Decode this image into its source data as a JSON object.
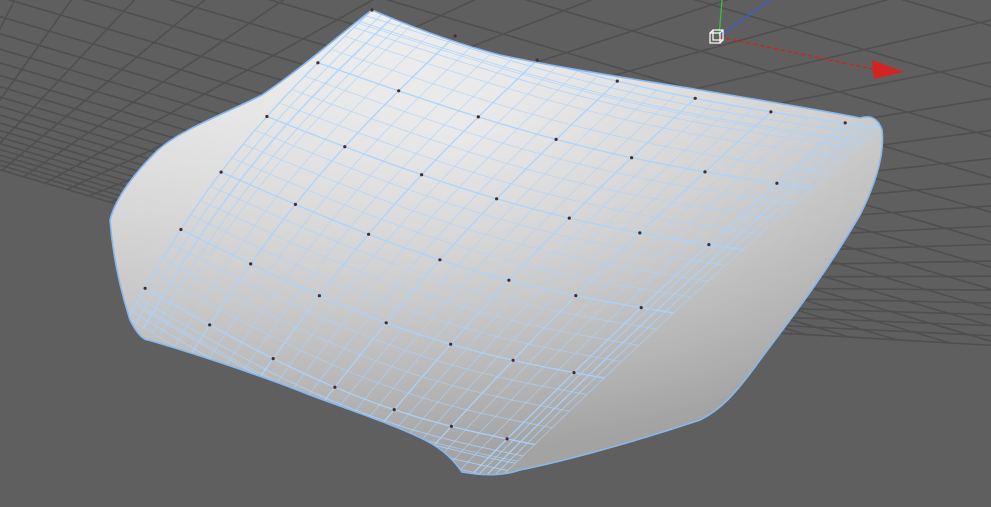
{
  "viewport": {
    "background_color": "#5f5f5f",
    "grid_color": "#4f4f4f",
    "grid_visible": true
  },
  "model": {
    "object": "car-hood",
    "display_mode": "shaded-wireframe",
    "wire_color": "#a9d3ff",
    "edge_color": "#86b8ef",
    "vertex_color": "#4a2b2b",
    "shade_light": "#f2f2f2",
    "shade_dark": "#9a9a9a"
  },
  "gizmo": {
    "x_axis_color": "#e01b1b",
    "y_axis_color": "#3bbf3b",
    "z_axis_color": "#3b5bd9",
    "handle_color": "#ffffff",
    "x_arrow_color": "#d52222"
  }
}
